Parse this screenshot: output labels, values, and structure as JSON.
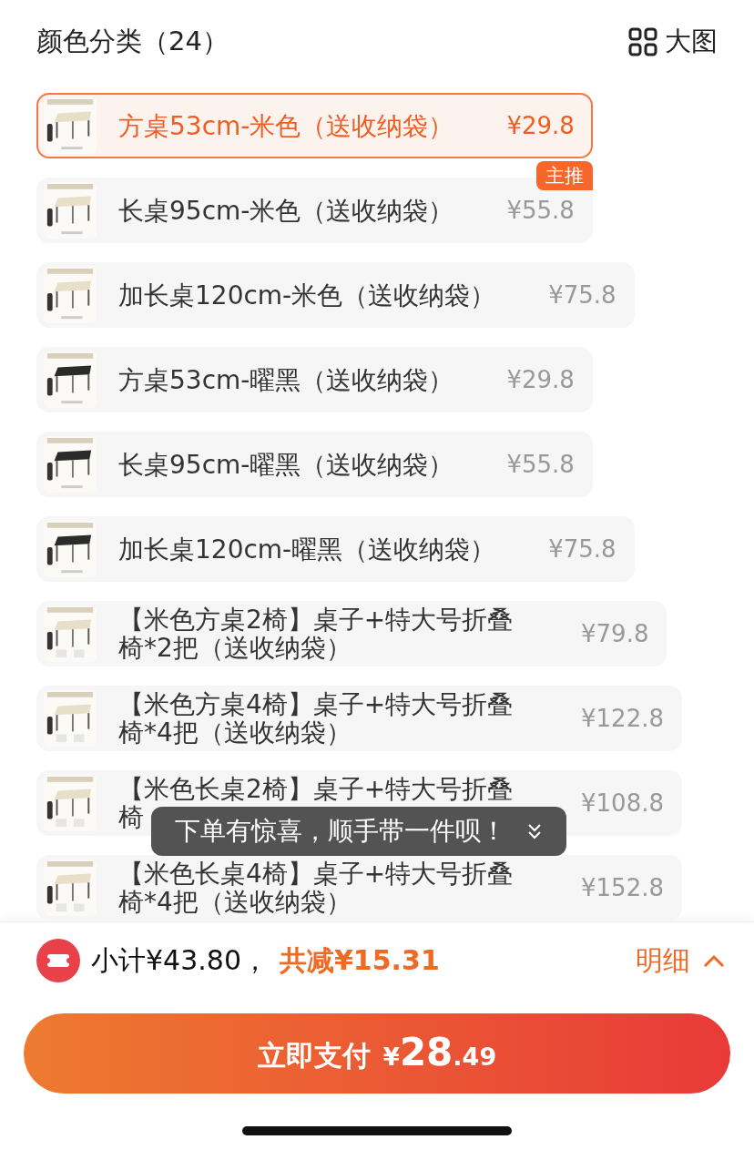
{
  "header": {
    "title": "颜色分类（24）",
    "view_toggle": "大图"
  },
  "options": [
    {
      "label": "方桌53cm-米色（送收纳袋）",
      "price": "¥29.8",
      "selected": true
    },
    {
      "label": "长桌95cm-米色（送收纳袋）",
      "price": "¥55.8",
      "selected": false,
      "badge": "主推"
    },
    {
      "label": "加长桌120cm-米色（送收纳袋）",
      "price": "¥75.8",
      "selected": false
    },
    {
      "label": "方桌53cm-曜黑（送收纳袋）",
      "price": "¥29.8",
      "selected": false
    },
    {
      "label": "长桌95cm-曜黑（送收纳袋）",
      "price": "¥55.8",
      "selected": false
    },
    {
      "label": "加长桌120cm-曜黑（送收纳袋）",
      "price": "¥75.8",
      "selected": false
    },
    {
      "label": "【米色方桌2椅】桌子+特大号折叠椅*2把（送收纳袋）",
      "price": "¥79.8",
      "selected": false
    },
    {
      "label": "【米色方桌4椅】桌子+特大号折叠椅*4把（送收纳袋）",
      "price": "¥122.8",
      "selected": false
    },
    {
      "label": "【米色长桌2椅】桌子+特大号折叠椅",
      "price": "¥108.8",
      "selected": false
    },
    {
      "label": "【米色长桌4椅】桌子+特大号折叠椅*4把（送收纳袋）",
      "price": "¥152.8",
      "selected": false
    }
  ],
  "toast": {
    "text": "下单有惊喜，顺手带一件呗！"
  },
  "summary": {
    "subtotal": "小计¥43.80，",
    "discount": "共减¥15.31",
    "details": "明细"
  },
  "pay_button": {
    "label": "立即支付",
    "currency": "¥",
    "integer": "28",
    "decimal": ".49"
  }
}
